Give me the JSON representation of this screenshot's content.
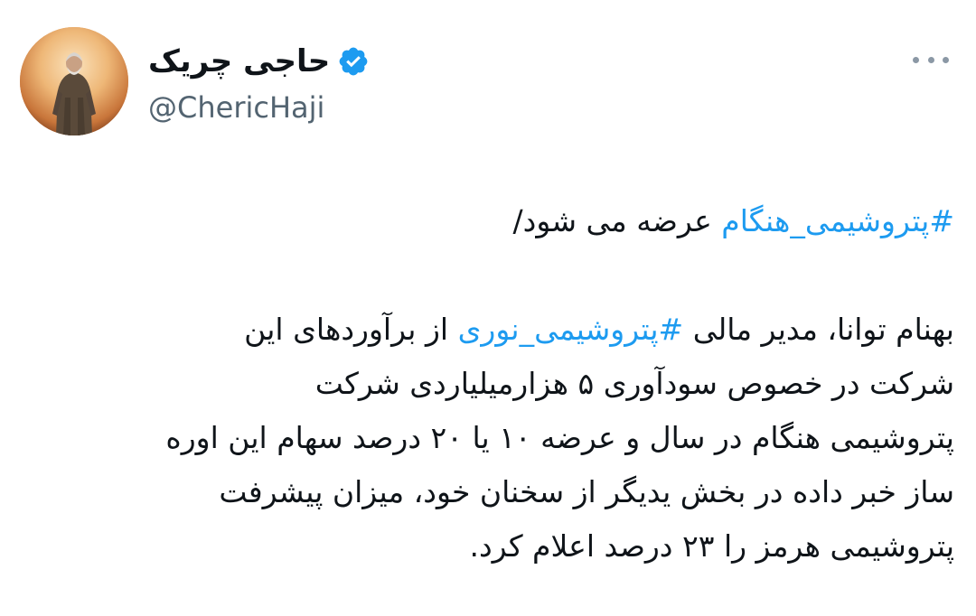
{
  "author": {
    "display_name": "حاجی چریک",
    "handle": "@ChericHaji",
    "verified": true,
    "avatar_icon": "avatar-portrait",
    "verified_color": "#1d9bf0"
  },
  "menu": {
    "more_icon": "more-horizontal-icon"
  },
  "tweet": {
    "line1": {
      "hashtag": "#پتروشیمی_هنگام",
      "text": " عرضه می شود/"
    },
    "line2": {
      "before": "بهنام توانا، مدیر مالی ",
      "hashtag": "#پتروشیمی_نوری",
      "after": " از برآوردهای این"
    },
    "line3": "شرکت در خصوص سودآوری ۵ هزارمیلیاردی شرکت",
    "line4": "پتروشیمی هنگام در سال و عرضه ۱۰ یا ۲۰ درصد سهام این اوره",
    "line5": "ساز خبر داده در بخش یدیگر از سخنان خود، میزان پیشرفت",
    "line6": "پتروشیمی هرمز را ۲۳ درصد اعلام کرد."
  },
  "colors": {
    "hashtag": "#1d9bf0",
    "text": "#0f1419",
    "secondary": "#536471"
  }
}
